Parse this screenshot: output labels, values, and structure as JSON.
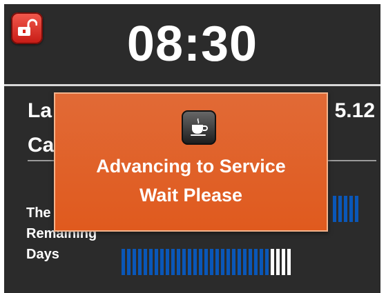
{
  "status": {
    "clock": "08:30",
    "lock_icon": "unlocked-padlock-icon",
    "lock_color": "#d9241c"
  },
  "info": {
    "row1_left": "La",
    "row1_right": "5.12",
    "row2_left": "Ca"
  },
  "bars": {
    "label_lines": [
      "The",
      "Remaining",
      "Days"
    ],
    "bar_color": "#0a57b8",
    "row1": {
      "filled": 5,
      "empty": 0
    },
    "row2": {
      "filled": 27,
      "empty": 4
    }
  },
  "dialog": {
    "icon": "coffee-cup-icon",
    "line1": "Advancing to Service",
    "line2": "Wait Please",
    "background": "#e05a1e"
  }
}
